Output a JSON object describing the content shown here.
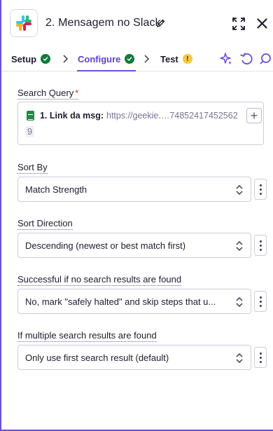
{
  "header": {
    "title": "2. Mensagem no Slack",
    "app_icon": "slack-logo",
    "edit_icon": "pencil-icon",
    "expand_icon": "expand-icon",
    "close_icon": "close-icon"
  },
  "tabs": [
    {
      "label": "Setup",
      "status": "complete"
    },
    {
      "label": "Configure",
      "status": "complete",
      "active": true
    },
    {
      "label": "Test",
      "status": "warning",
      "badge": "!"
    }
  ],
  "toolbar_icons": [
    "sparkle-icon",
    "refresh-icon",
    "search-icon"
  ],
  "fields": {
    "search_query": {
      "label": "Search Query",
      "required_mark": "*",
      "pill_label": "1. Link da msg:",
      "pill_value": "https://geekie.…74852417452562",
      "pill_tail": "9",
      "add_label": "+"
    },
    "sort_by": {
      "label": "Sort By",
      "value": "Match Strength"
    },
    "sort_direction": {
      "label": "Sort Direction",
      "value": "Descending (newest or best match first)"
    },
    "no_results": {
      "label": "Successful if no search results are found",
      "value": "No, mark \"safely halted\" and skip steps that u..."
    },
    "multiple_results": {
      "label": "If multiple search results are found",
      "value": "Only use first search result (default)"
    }
  },
  "colors": {
    "accent": "#6b4fd8",
    "success": "#137a3a",
    "warning": "#f5c842"
  }
}
